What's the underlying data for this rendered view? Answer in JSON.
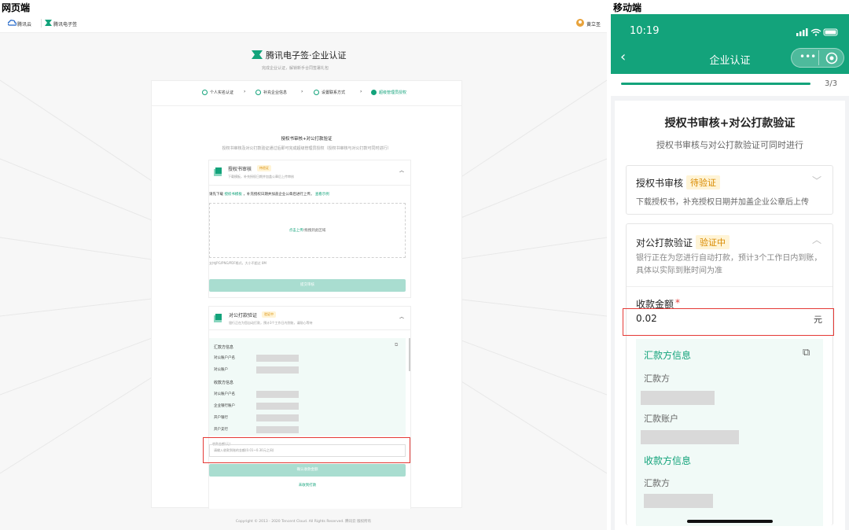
{
  "labels": {
    "web": "网页端",
    "mobile": "移动端"
  },
  "web": {
    "brand1": "腾讯云",
    "brand2": "腾讯电子签",
    "user": "黄立圣",
    "title": "腾讯电子签·企业认证",
    "subtitle": "完成企业认证，解锁新手合同签署礼包",
    "steps": [
      "个人实名认证",
      "补充企业信息",
      "设置联系方式",
      "超级管理员授权"
    ],
    "section_title": "授权书审核+对公打款验证",
    "section_desc": "授权书审核及对公打款验证通过后即可完成超级管理员授权（授权书审核与对公打款可同时进行）",
    "auth": {
      "title": "授权书审核",
      "badge": "待验证",
      "desc": "下载模板，补充授权日期并加盖公章后上传审核",
      "download_prefix": "请先下载",
      "template_link": "授权书模板",
      "download_suffix": "，补充授权日期并加盖企业公章后进行上传。",
      "example_link": "查看示例",
      "upload_link": "点击上传",
      "upload_suffix": "/拖拽到此区域",
      "file_hint": "支持JPG/PNG/PDF格式，大小不超过 8M",
      "submit": "提交审核"
    },
    "pay": {
      "title": "对公打款验证",
      "badge": "验证中",
      "desc": "银行正在为您自动打款，预计3个工作日内到账，请耐心等待",
      "payer_title": "汇款方信息",
      "payer_fields": [
        "对公账户户名",
        "对公账户"
      ],
      "payee_title": "收款方信息",
      "payee_fields": [
        "对公账户户名",
        "企业银行账户",
        "开户银行",
        "开户支行"
      ],
      "amount_label": "收款金额(元)",
      "amount_placeholder": "请输入收款到账的金额(0.01~0.30元之间)",
      "confirm": "确认收款金额",
      "not_received": "未收到打款"
    },
    "footer": "Copyright © 2013 - 2020 Tencent Cloud. All Rights Reserved. 腾讯云 版权所有"
  },
  "mobile": {
    "time": "10:19",
    "nav_title": "企业认证",
    "progress": 1.0,
    "progress_text": "3/3",
    "title": "授权书审核+对公打款验证",
    "subtitle": "授权书审核与对公打款验证可同时进行",
    "auth": {
      "title": "授权书审核",
      "badge": "待验证",
      "desc": "下载授权书，补充授权日期并加盖企业公章后上传"
    },
    "pay": {
      "title": "对公打款验证",
      "badge": "验证中",
      "desc": "银行正在为您进行自动打款，预计3个工作日内到账，具体以实际到账时间为准",
      "amount_label": "收款金额",
      "required": "*",
      "amount_value": "0.02",
      "unit": "元",
      "payer_title": "汇款方信息",
      "payer_fields": [
        "汇款方",
        "汇款账户"
      ],
      "payee_title": "收款方信息",
      "payee_fields": [
        "汇款方"
      ]
    }
  },
  "colors": {
    "accent": "#13a37b",
    "highlight": "#e53935",
    "badge": "#d98a00"
  }
}
